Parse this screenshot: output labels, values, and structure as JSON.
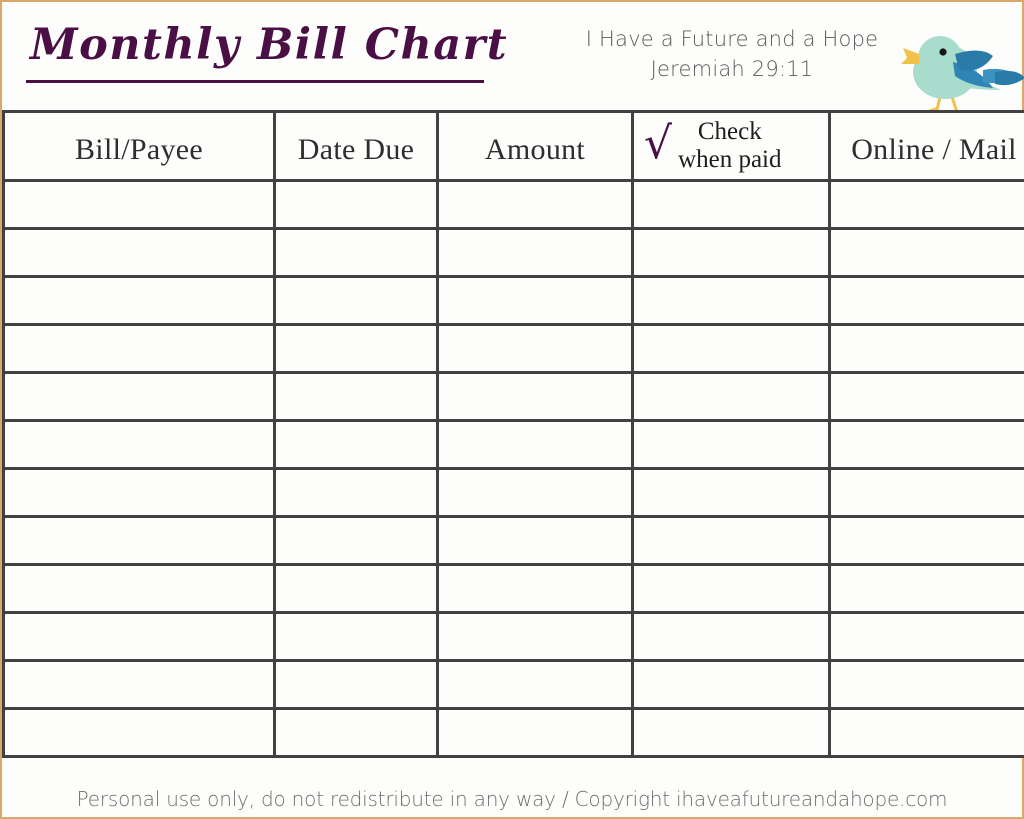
{
  "document": {
    "title": "Monthly Bill Chart",
    "verse_text": "I Have a Future and a Hope",
    "verse_reference": "Jeremiah 29:11",
    "footer": "Personal use only, do not redistribute in any way / Copyright ihaveafutureandahope.com",
    "bird_icon_name": "bird-illustration"
  },
  "colors": {
    "page_border": "#d9a96b",
    "title_purple": "#4a1045",
    "grid_line": "#414141",
    "header_text": "#2e2e2e",
    "verse_text": "#5a5a5a",
    "footer_text": "#6e6e6e",
    "bird_body": "#a8ddcd",
    "bird_wing": "#2b7ba8",
    "bird_wing_light": "#4a9bc4",
    "bird_beak": "#f2c14a"
  },
  "table": {
    "columns": [
      {
        "label": "Bill/Payee"
      },
      {
        "label": "Date Due"
      },
      {
        "label": "Amount"
      },
      {
        "label_line1": "Check",
        "label_line2": "when paid",
        "check_glyph": "√"
      },
      {
        "label": "Online / Mail"
      }
    ],
    "row_count": 12,
    "rows": [
      {
        "bill_payee": "",
        "date_due": "",
        "amount": "",
        "check_when_paid": "",
        "online_mail": ""
      },
      {
        "bill_payee": "",
        "date_due": "",
        "amount": "",
        "check_when_paid": "",
        "online_mail": ""
      },
      {
        "bill_payee": "",
        "date_due": "",
        "amount": "",
        "check_when_paid": "",
        "online_mail": ""
      },
      {
        "bill_payee": "",
        "date_due": "",
        "amount": "",
        "check_when_paid": "",
        "online_mail": ""
      },
      {
        "bill_payee": "",
        "date_due": "",
        "amount": "",
        "check_when_paid": "",
        "online_mail": ""
      },
      {
        "bill_payee": "",
        "date_due": "",
        "amount": "",
        "check_when_paid": "",
        "online_mail": ""
      },
      {
        "bill_payee": "",
        "date_due": "",
        "amount": "",
        "check_when_paid": "",
        "online_mail": ""
      },
      {
        "bill_payee": "",
        "date_due": "",
        "amount": "",
        "check_when_paid": "",
        "online_mail": ""
      },
      {
        "bill_payee": "",
        "date_due": "",
        "amount": "",
        "check_when_paid": "",
        "online_mail": ""
      },
      {
        "bill_payee": "",
        "date_due": "",
        "amount": "",
        "check_when_paid": "",
        "online_mail": ""
      },
      {
        "bill_payee": "",
        "date_due": "",
        "amount": "",
        "check_when_paid": "",
        "online_mail": ""
      },
      {
        "bill_payee": "",
        "date_due": "",
        "amount": "",
        "check_when_paid": "",
        "online_mail": ""
      }
    ]
  }
}
